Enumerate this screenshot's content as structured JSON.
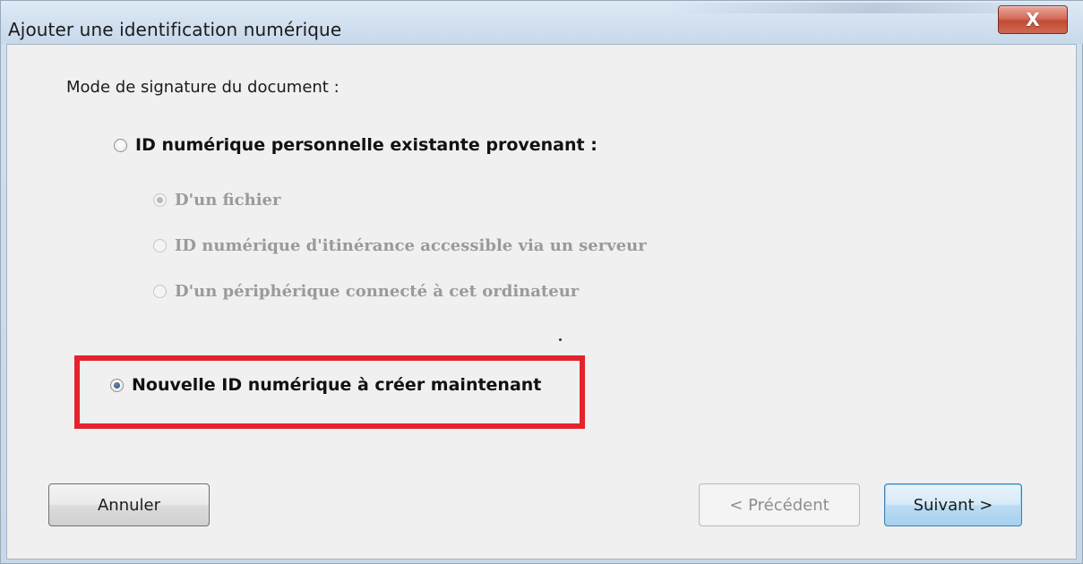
{
  "window": {
    "title": "Ajouter une identification numérique",
    "close_label": "X"
  },
  "form": {
    "prompt": "Mode de signature du document :",
    "options": [
      {
        "label": "ID numérique personnelle existante provenant :",
        "selected": false,
        "enabled": true
      },
      {
        "label": "D'un fichier",
        "selected": true,
        "enabled": false
      },
      {
        "label": "ID numérique d'itinérance accessible via un serveur",
        "selected": false,
        "enabled": false
      },
      {
        "label": "D'un périphérique connecté à cet ordinateur",
        "selected": false,
        "enabled": false
      },
      {
        "label": "Nouvelle ID numérique à créer maintenant",
        "selected": true,
        "enabled": true
      }
    ]
  },
  "buttons": {
    "cancel": "Annuler",
    "previous": "< Précédent",
    "next": "Suivant >"
  },
  "colors": {
    "highlight": "#e4232c",
    "title_bg": "#d1e0ef",
    "close_red": "#c24c35"
  }
}
